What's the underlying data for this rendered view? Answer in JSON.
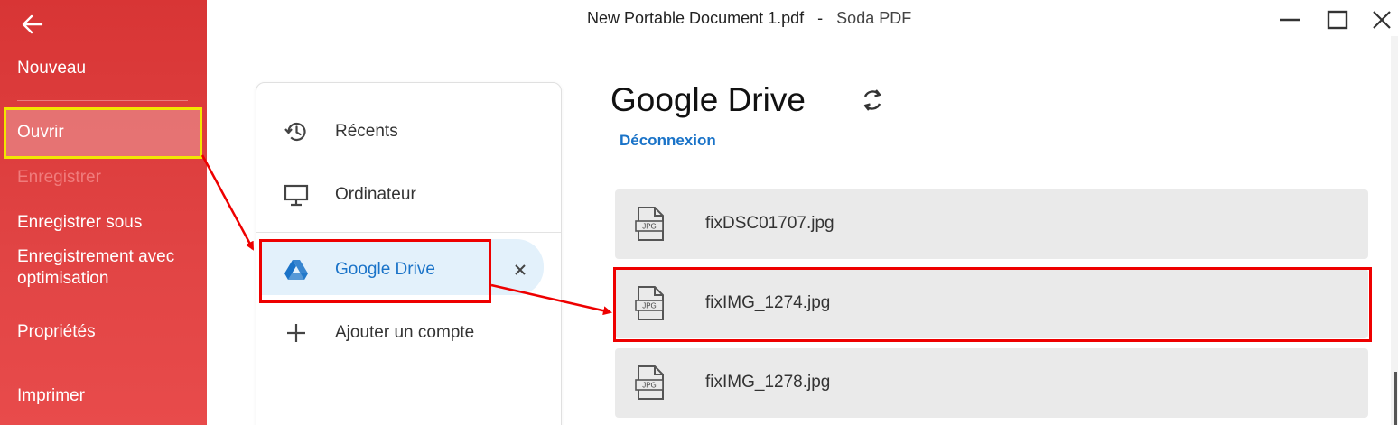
{
  "window": {
    "document_title": "New Portable Document 1.pdf",
    "separator": "-",
    "app_name": "Soda PDF"
  },
  "sidebar": {
    "items": [
      {
        "label": "Nouveau",
        "enabled": true
      },
      {
        "label": "Ouvrir",
        "enabled": true,
        "selected": true
      },
      {
        "label": "Enregistrer",
        "enabled": false
      },
      {
        "label": "Enregistrer sous",
        "enabled": true
      },
      {
        "label": "Enregistrement avec optimisation",
        "enabled": true
      },
      {
        "label": "Propriétés",
        "enabled": true
      },
      {
        "label": "Imprimer",
        "enabled": true
      }
    ]
  },
  "locations": {
    "items": [
      {
        "label": "Récents",
        "icon": "history-icon"
      },
      {
        "label": "Ordinateur",
        "icon": "monitor-icon"
      },
      {
        "label": "Google Drive",
        "icon": "google-drive-icon",
        "selected": true
      },
      {
        "label": "Ajouter un compte",
        "icon": "plus-icon"
      }
    ]
  },
  "main": {
    "title": "Google Drive",
    "disconnect_label": "Déconnexion",
    "files": [
      {
        "name": "fixDSC01707.jpg",
        "type": "JPG"
      },
      {
        "name": "fixIMG_1274.jpg",
        "type": "JPG",
        "highlighted": true
      },
      {
        "name": "fixIMG_1278.jpg",
        "type": "JPG"
      }
    ]
  },
  "colors": {
    "sidebar_red": "#d83535",
    "link_blue": "#1a73c8",
    "annotation_red": "#ee0000",
    "annotation_yellow": "#f2e600"
  }
}
